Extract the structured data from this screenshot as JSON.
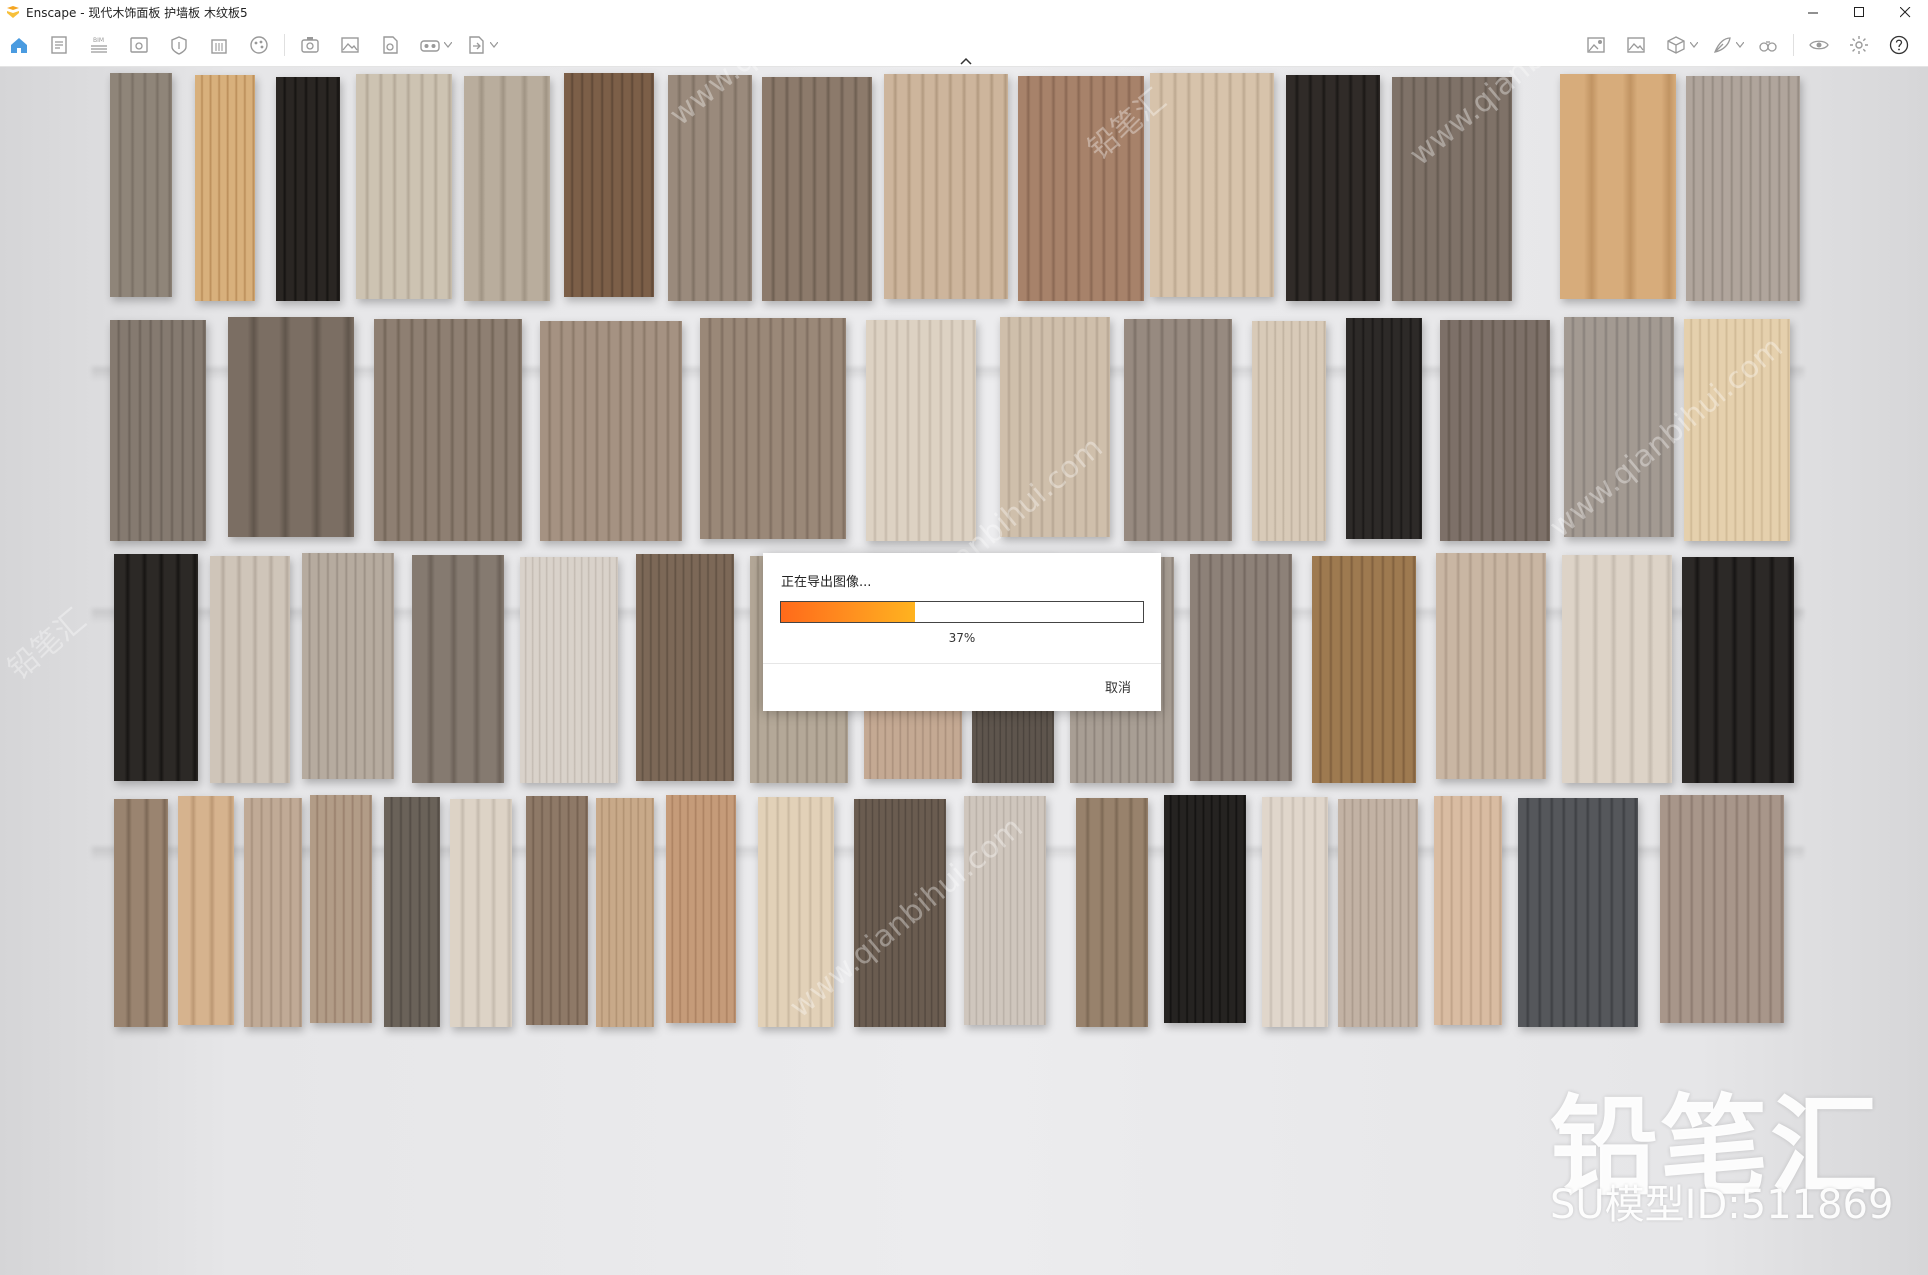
{
  "window": {
    "title": "Enscape - 现代木饰面板 护墙板 木纹板5",
    "controls": {
      "minimize_icon": "minimize-icon",
      "maximize_icon": "maximize-icon",
      "close_icon": "close-icon"
    }
  },
  "toolbar": {
    "left_icons": [
      "home-icon",
      "document-icon",
      "bim-icon",
      "render-window-icon",
      "asset-library-icon",
      "building-icon",
      "material-icon",
      "capture-icon",
      "image-icon",
      "batch-render-icon",
      "vr-headset-icon",
      "export-icon"
    ],
    "right_icons": [
      "screenshot-icon",
      "landscape-icon",
      "cube-icon",
      "feather-icon",
      "binoculars-icon",
      "visibility-icon",
      "settings-icon",
      "help-icon"
    ],
    "accent_color": "#4a9be0"
  },
  "watermark": {
    "brand": "铅笔汇",
    "model_id": "SU模型ID:511869",
    "url_text": "www.qianbihui.com"
  },
  "export_dialog": {
    "title": "正在导出图像...",
    "progress_percent": 37,
    "progress_label": "37%",
    "cancel_label": "取消"
  }
}
